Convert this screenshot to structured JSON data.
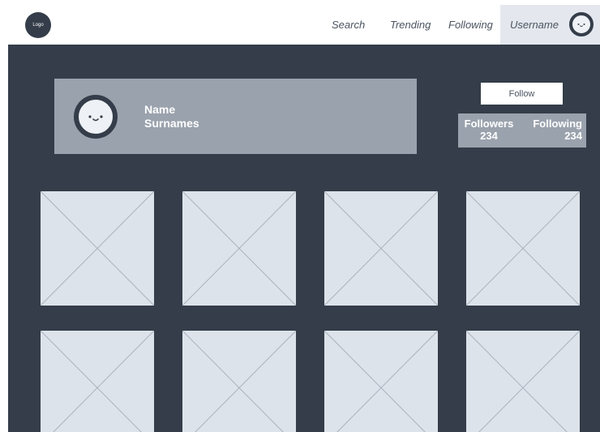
{
  "header": {
    "logo_text": "Logo",
    "nav": [
      "Search",
      "Trending",
      "Following"
    ],
    "username": "Username"
  },
  "profile": {
    "first_name": "Name",
    "surname": "Surnames",
    "follow_label": "Follow",
    "followers_label": "Followers",
    "followers_count": "234",
    "following_label": "Following",
    "following_count": "234"
  },
  "colors": {
    "background": "#343d49",
    "card": "#9aa2ad",
    "placeholder": "#dde3ea",
    "highlight": "#e4e8ee"
  },
  "icons": [
    "smiley-avatar-icon",
    "image-placeholder-icon"
  ]
}
